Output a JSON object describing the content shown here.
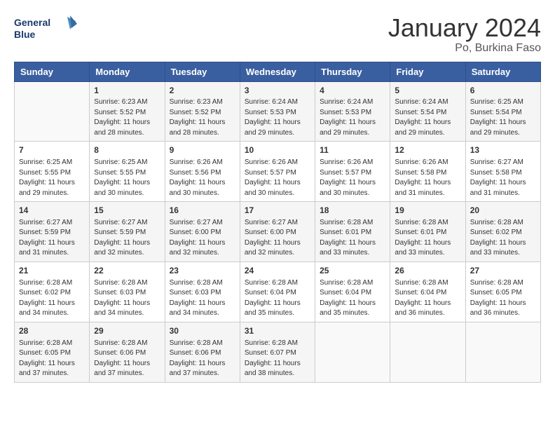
{
  "header": {
    "logo_line1": "General",
    "logo_line2": "Blue",
    "month_title": "January 2024",
    "location": "Po, Burkina Faso"
  },
  "weekdays": [
    "Sunday",
    "Monday",
    "Tuesday",
    "Wednesday",
    "Thursday",
    "Friday",
    "Saturday"
  ],
  "weeks": [
    [
      {
        "day": "",
        "info": ""
      },
      {
        "day": "1",
        "info": "Sunrise: 6:23 AM\nSunset: 5:52 PM\nDaylight: 11 hours\nand 28 minutes."
      },
      {
        "day": "2",
        "info": "Sunrise: 6:23 AM\nSunset: 5:52 PM\nDaylight: 11 hours\nand 28 minutes."
      },
      {
        "day": "3",
        "info": "Sunrise: 6:24 AM\nSunset: 5:53 PM\nDaylight: 11 hours\nand 29 minutes."
      },
      {
        "day": "4",
        "info": "Sunrise: 6:24 AM\nSunset: 5:53 PM\nDaylight: 11 hours\nand 29 minutes."
      },
      {
        "day": "5",
        "info": "Sunrise: 6:24 AM\nSunset: 5:54 PM\nDaylight: 11 hours\nand 29 minutes."
      },
      {
        "day": "6",
        "info": "Sunrise: 6:25 AM\nSunset: 5:54 PM\nDaylight: 11 hours\nand 29 minutes."
      }
    ],
    [
      {
        "day": "7",
        "info": "Sunrise: 6:25 AM\nSunset: 5:55 PM\nDaylight: 11 hours\nand 29 minutes."
      },
      {
        "day": "8",
        "info": "Sunrise: 6:25 AM\nSunset: 5:55 PM\nDaylight: 11 hours\nand 30 minutes."
      },
      {
        "day": "9",
        "info": "Sunrise: 6:26 AM\nSunset: 5:56 PM\nDaylight: 11 hours\nand 30 minutes."
      },
      {
        "day": "10",
        "info": "Sunrise: 6:26 AM\nSunset: 5:57 PM\nDaylight: 11 hours\nand 30 minutes."
      },
      {
        "day": "11",
        "info": "Sunrise: 6:26 AM\nSunset: 5:57 PM\nDaylight: 11 hours\nand 30 minutes."
      },
      {
        "day": "12",
        "info": "Sunrise: 6:26 AM\nSunset: 5:58 PM\nDaylight: 11 hours\nand 31 minutes."
      },
      {
        "day": "13",
        "info": "Sunrise: 6:27 AM\nSunset: 5:58 PM\nDaylight: 11 hours\nand 31 minutes."
      }
    ],
    [
      {
        "day": "14",
        "info": "Sunrise: 6:27 AM\nSunset: 5:59 PM\nDaylight: 11 hours\nand 31 minutes."
      },
      {
        "day": "15",
        "info": "Sunrise: 6:27 AM\nSunset: 5:59 PM\nDaylight: 11 hours\nand 32 minutes."
      },
      {
        "day": "16",
        "info": "Sunrise: 6:27 AM\nSunset: 6:00 PM\nDaylight: 11 hours\nand 32 minutes."
      },
      {
        "day": "17",
        "info": "Sunrise: 6:27 AM\nSunset: 6:00 PM\nDaylight: 11 hours\nand 32 minutes."
      },
      {
        "day": "18",
        "info": "Sunrise: 6:28 AM\nSunset: 6:01 PM\nDaylight: 11 hours\nand 33 minutes."
      },
      {
        "day": "19",
        "info": "Sunrise: 6:28 AM\nSunset: 6:01 PM\nDaylight: 11 hours\nand 33 minutes."
      },
      {
        "day": "20",
        "info": "Sunrise: 6:28 AM\nSunset: 6:02 PM\nDaylight: 11 hours\nand 33 minutes."
      }
    ],
    [
      {
        "day": "21",
        "info": "Sunrise: 6:28 AM\nSunset: 6:02 PM\nDaylight: 11 hours\nand 34 minutes."
      },
      {
        "day": "22",
        "info": "Sunrise: 6:28 AM\nSunset: 6:03 PM\nDaylight: 11 hours\nand 34 minutes."
      },
      {
        "day": "23",
        "info": "Sunrise: 6:28 AM\nSunset: 6:03 PM\nDaylight: 11 hours\nand 34 minutes."
      },
      {
        "day": "24",
        "info": "Sunrise: 6:28 AM\nSunset: 6:04 PM\nDaylight: 11 hours\nand 35 minutes."
      },
      {
        "day": "25",
        "info": "Sunrise: 6:28 AM\nSunset: 6:04 PM\nDaylight: 11 hours\nand 35 minutes."
      },
      {
        "day": "26",
        "info": "Sunrise: 6:28 AM\nSunset: 6:04 PM\nDaylight: 11 hours\nand 36 minutes."
      },
      {
        "day": "27",
        "info": "Sunrise: 6:28 AM\nSunset: 6:05 PM\nDaylight: 11 hours\nand 36 minutes."
      }
    ],
    [
      {
        "day": "28",
        "info": "Sunrise: 6:28 AM\nSunset: 6:05 PM\nDaylight: 11 hours\nand 37 minutes."
      },
      {
        "day": "29",
        "info": "Sunrise: 6:28 AM\nSunset: 6:06 PM\nDaylight: 11 hours\nand 37 minutes."
      },
      {
        "day": "30",
        "info": "Sunrise: 6:28 AM\nSunset: 6:06 PM\nDaylight: 11 hours\nand 37 minutes."
      },
      {
        "day": "31",
        "info": "Sunrise: 6:28 AM\nSunset: 6:07 PM\nDaylight: 11 hours\nand 38 minutes."
      },
      {
        "day": "",
        "info": ""
      },
      {
        "day": "",
        "info": ""
      },
      {
        "day": "",
        "info": ""
      }
    ]
  ]
}
